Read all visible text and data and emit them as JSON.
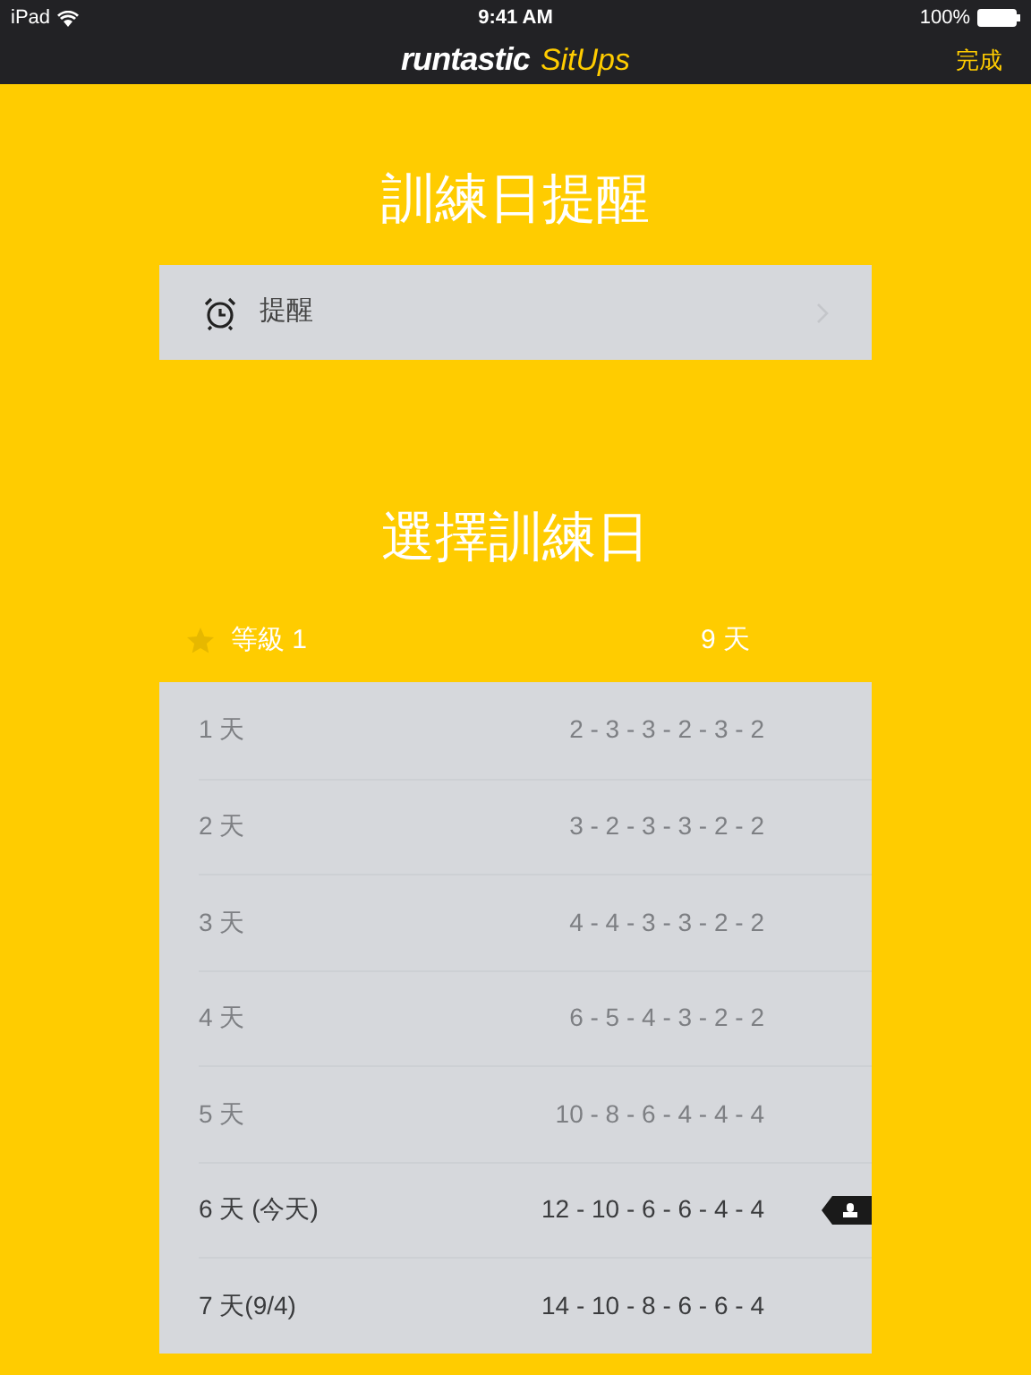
{
  "status_bar": {
    "device": "iPad",
    "time": "9:41 AM",
    "battery": "100%"
  },
  "nav": {
    "brand": "runtastic",
    "product": "SitUps",
    "done": "完成"
  },
  "reminder_section": {
    "title": "訓練日提醒",
    "item": {
      "label": "提醒"
    }
  },
  "days_section": {
    "title": "選擇訓練日",
    "level": {
      "label": "等級 1",
      "days": "9 天"
    },
    "rows": [
      {
        "day": "1 天",
        "reps": "2 - 3 - 3 - 2 - 3 - 2",
        "past": true,
        "selected": false
      },
      {
        "day": "2 天",
        "reps": "3 - 2 - 3 - 3 - 2 - 2",
        "past": true,
        "selected": false
      },
      {
        "day": "3 天",
        "reps": "4 - 4 - 3 - 3 - 2 - 2",
        "past": true,
        "selected": false
      },
      {
        "day": "4 天",
        "reps": "6 - 5 - 4 - 3 - 2 - 2",
        "past": true,
        "selected": false
      },
      {
        "day": "5 天",
        "reps": "10 - 8 - 6 - 4 - 4 - 4",
        "past": true,
        "selected": false
      },
      {
        "day": "6 天 (今天)",
        "reps": "12 - 10 - 6 - 6 - 4 - 4",
        "past": false,
        "selected": true
      },
      {
        "day": "7 天(9/4)",
        "reps": "14 - 10 - 8 - 6 - 6 - 4",
        "past": false,
        "selected": false
      }
    ]
  }
}
